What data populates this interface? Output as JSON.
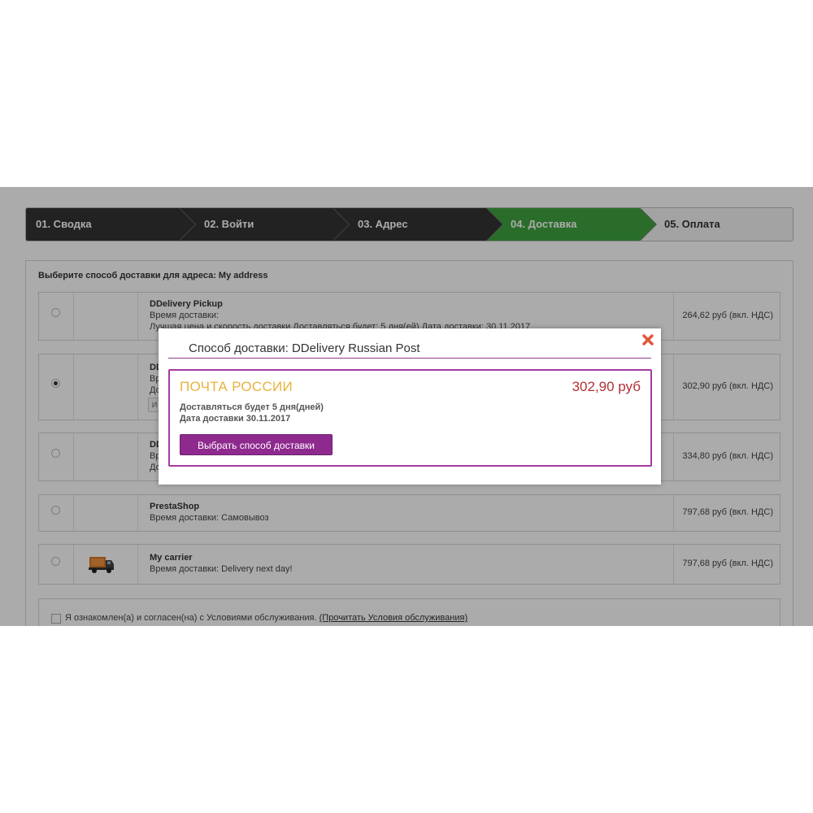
{
  "steps": [
    {
      "label": "01. Сводка"
    },
    {
      "label": "02. Войти"
    },
    {
      "label": "03. Адрес"
    },
    {
      "label": "04. Доставка"
    },
    {
      "label": "05. Оплата"
    }
  ],
  "delivery_heading": "Выберите способ доставки для адреса: My address",
  "carriers": [
    {
      "name": "DDelivery Pickup",
      "line1": "Время доставки:",
      "line2": "Лучшая цена и скорость доставки Доставляться будет: 5 дня(ей) Дата доставки: 30.11.2017",
      "price": "264,62 руб (вкл. НДС)"
    },
    {
      "name": "DD",
      "line1": "Вр",
      "line2": "До",
      "button": "И",
      "price": "302,90 руб (вкл. НДС)"
    },
    {
      "name": "DD",
      "line1": "Вр",
      "line2": "До",
      "price": "334,80 руб (вкл. НДС)"
    },
    {
      "name": "PrestaShop",
      "line1": "Время доставки: Самовывоз",
      "price": "797,68 руб (вкл. НДС)"
    },
    {
      "name": "My carrier",
      "line1": "Время доставки: Delivery next day!",
      "price": "797,68 руб (вкл. НДС)"
    }
  ],
  "terms": {
    "text": "Я ознакомлен(а) и согласен(на) с Условиями обслуживания.",
    "link": "(Прочитать Условия обслуживания)"
  },
  "modal": {
    "title": "Способ доставки: DDelivery Russian Post",
    "option_name": "ПОЧТА РОССИИ",
    "option_price": "302,90 руб",
    "delivery_days": "Доставляться будет 5 дня(дней)",
    "delivery_date": "Дата доставки 30.11.2017",
    "choose_button": "Выбрать способ доставки",
    "close_icon": "close-icon"
  },
  "colors": {
    "step_active": "#3fa33f",
    "step_done": "#333333",
    "modal_accent": "#8e2a8e",
    "option_name": "#e7b33c",
    "option_price": "#b13036",
    "close": "#e2543a"
  }
}
